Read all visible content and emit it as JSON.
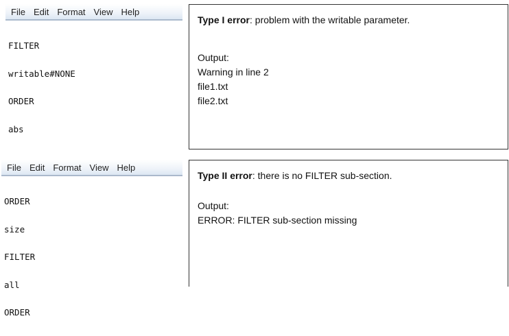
{
  "notepad_top": {
    "menu": [
      "File",
      "Edit",
      "Format",
      "View",
      "Help"
    ],
    "lines": [
      "FILTER",
      "writable#NONE",
      "ORDER",
      "abs"
    ]
  },
  "notepad_bottom": {
    "menu": [
      "File",
      "Edit",
      "Format",
      "View",
      "Help"
    ],
    "lines": [
      "ORDER",
      "size",
      "FILTER",
      "all",
      "ORDER"
    ]
  },
  "panel_top": {
    "title_bold": "Type I error",
    "title_rest": ": problem  with the writable parameter.",
    "output_label": "Output:",
    "output_lines": [
      "Warning in line 2",
      "file1.txt",
      "file2.txt"
    ]
  },
  "panel_bottom": {
    "title_bold": "Type II error",
    "title_rest": ": there is no FILTER sub-section.",
    "output_label": "Output:",
    "output_lines": [
      "ERROR: FILTER sub-section missing"
    ]
  }
}
